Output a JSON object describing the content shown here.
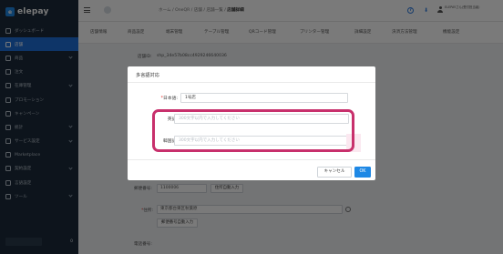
{
  "app": {
    "name": "elepay"
  },
  "sidebar": {
    "items": [
      {
        "label": "ダッシュボード",
        "icon": "dashboard-icon",
        "active": false,
        "chevron": false
      },
      {
        "label": "店舗",
        "icon": "store-icon",
        "active": true,
        "chevron": false
      },
      {
        "label": "商品",
        "icon": "tag-icon",
        "active": false,
        "chevron": true
      },
      {
        "label": "注文",
        "icon": "cart-icon",
        "active": false,
        "chevron": false
      },
      {
        "label": "在庫管理",
        "icon": "box-icon",
        "active": false,
        "chevron": true
      },
      {
        "label": "プロモーション",
        "icon": "gift-icon",
        "active": false,
        "chevron": false
      },
      {
        "label": "キャンペーン",
        "icon": "megaphone-icon",
        "active": false,
        "chevron": false
      },
      {
        "label": "統計",
        "icon": "chart-icon",
        "active": false,
        "chevron": true
      },
      {
        "label": "サービス設定",
        "icon": "gear-icon",
        "active": false,
        "chevron": true
      },
      {
        "label": "Marketplace",
        "icon": "grid-icon",
        "active": false,
        "chevron": false
      },
      {
        "label": "契約設定",
        "icon": "document-icon",
        "active": false,
        "chevron": true
      },
      {
        "label": "言語設定",
        "icon": "globe-icon",
        "active": false,
        "chevron": false
      },
      {
        "label": "ツール",
        "icon": "tool-icon",
        "active": false,
        "chevron": true
      }
    ],
    "footer_value": "0"
  },
  "header": {
    "breadcrumb": [
      "ホーム",
      "OneQR",
      "店舗",
      "店舗一覧"
    ],
    "breadcrumb_current": "店舗詳細",
    "user_name": "ELEPAYさん(受付担当者)"
  },
  "tabs": [
    {
      "label": "店舗情報",
      "active": true
    },
    {
      "label": "商品設定",
      "active": false
    },
    {
      "label": "端末管理",
      "active": false
    },
    {
      "label": "テーブル管理",
      "active": false
    },
    {
      "label": "QRコード管理",
      "active": false
    },
    {
      "label": "プリンター管理",
      "active": false
    },
    {
      "label": "詳細設定",
      "active": false
    },
    {
      "label": "決済方法管理",
      "active": false
    },
    {
      "label": "機能設定",
      "active": false
    }
  ],
  "store": {
    "id_label": "店舗ID:",
    "id_value": "shp_34e57b08cc4929246640036",
    "postal_label": "郵便番号:",
    "postal_value": "1100006",
    "postal_button": "住所自動入力",
    "address_label": "住所:",
    "address_value": "東京都台東区秋葉原",
    "address_button": "郵便番号自動入力",
    "phone_label": "電話番号:"
  },
  "modal": {
    "title": "多言語対応",
    "fields": [
      {
        "label": "日本語:",
        "required": true,
        "value": "1号店",
        "placeholder": ""
      },
      {
        "label": "英語:",
        "required": false,
        "value": "",
        "placeholder": "300文字以内で入力してください"
      },
      {
        "label": "韓国語:",
        "required": false,
        "value": "",
        "placeholder": "300文字以内で入力してください"
      }
    ],
    "cancel_label": "キャンセル",
    "ok_label": "OK"
  },
  "colors": {
    "sidebar_bg": "#1c2b3b",
    "accent": "#1e6fd9",
    "primary_button": "#1e88e5",
    "highlight": "#c8306c"
  }
}
